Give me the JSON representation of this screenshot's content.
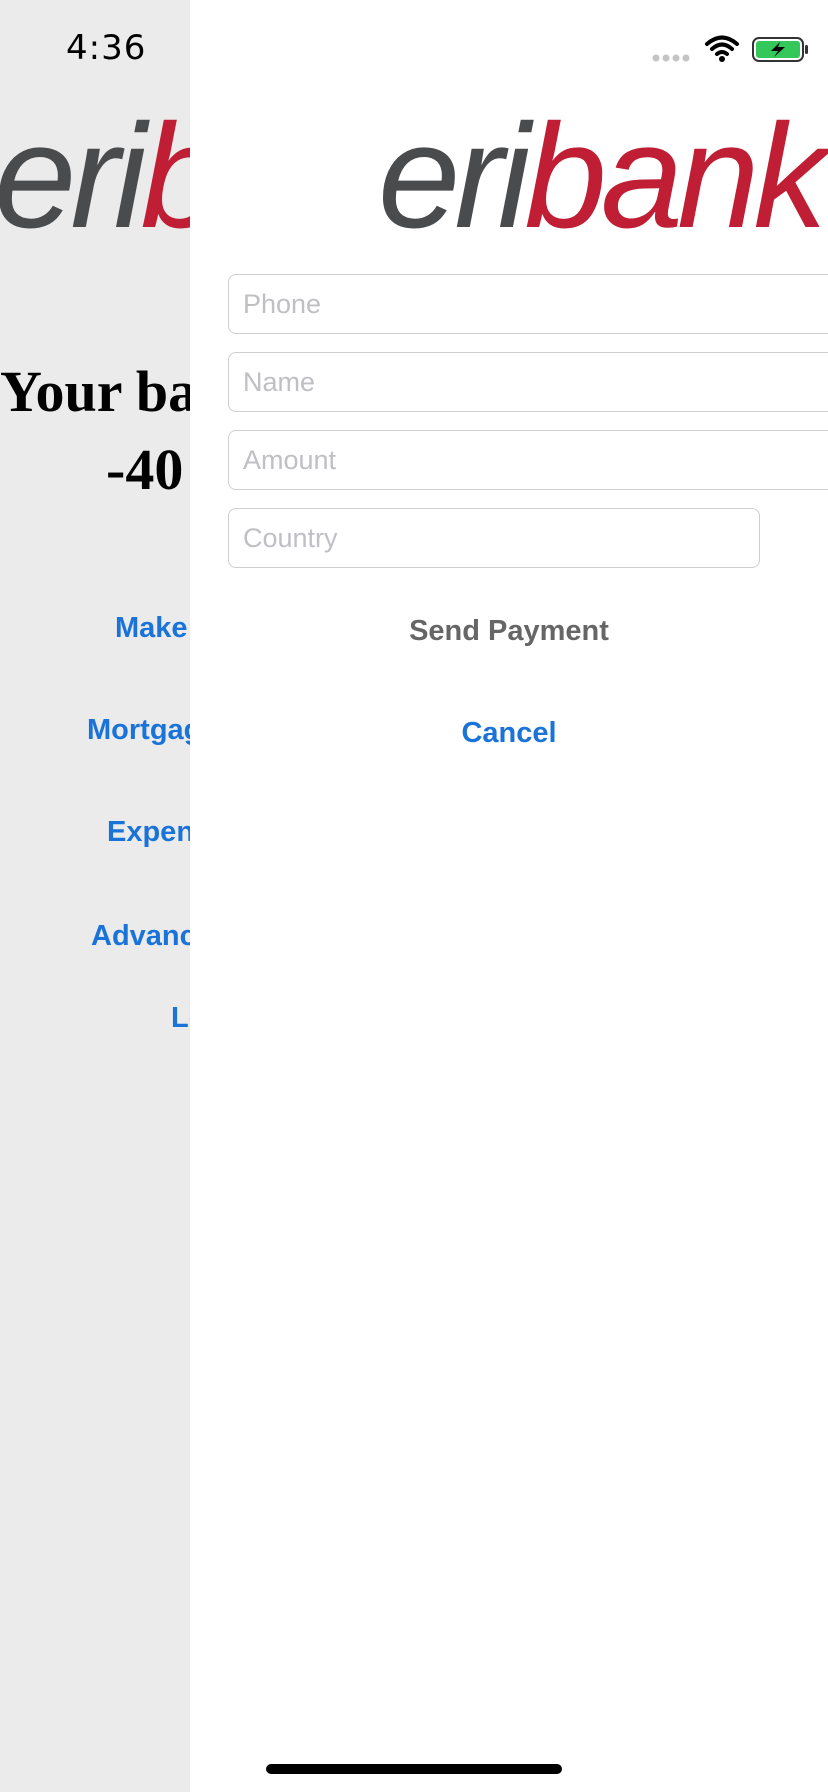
{
  "status_bar": {
    "time": "4:36"
  },
  "background": {
    "logo": {
      "eri": "eri",
      "bank": "bank"
    },
    "balance_title": "Your balance is:",
    "balance_value": "-40",
    "links": [
      "Make payment",
      "Mortgage request",
      "Expense report",
      "Advanced search",
      "Logout"
    ]
  },
  "sheet": {
    "logo": {
      "eri": "eri",
      "bank": "bank"
    },
    "fields": {
      "phone_placeholder": "Phone",
      "name_placeholder": "Name",
      "amount_placeholder": "Amount",
      "country_placeholder": "Country"
    },
    "send_label": "Send Payment",
    "cancel_label": "Cancel"
  },
  "colors": {
    "brand_red": "#c01e34",
    "brand_gray": "#4a4b4d",
    "link_blue": "#1a73d9",
    "battery_green": "#34c759"
  }
}
